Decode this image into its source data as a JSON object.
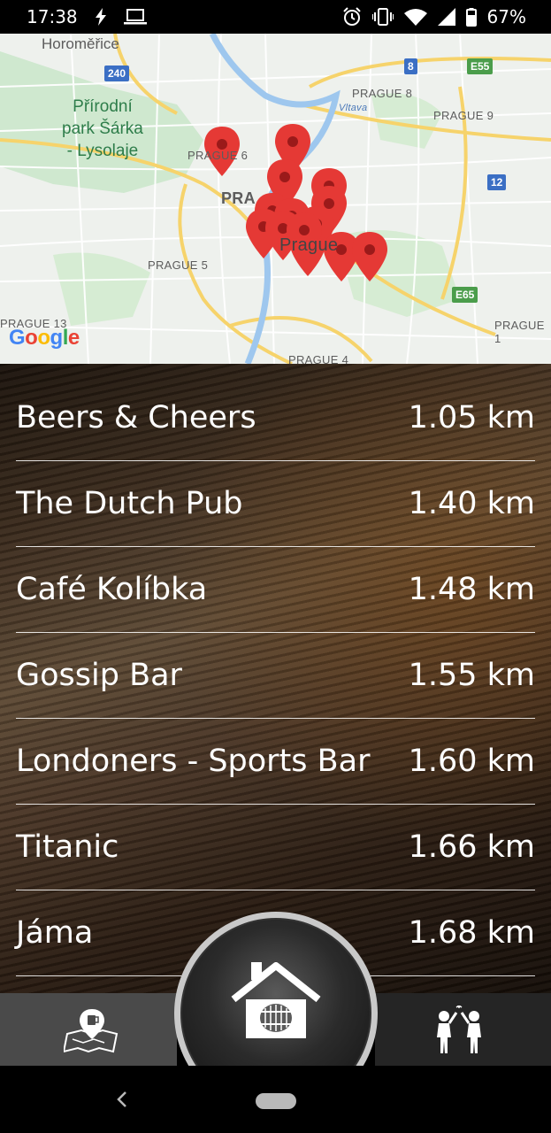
{
  "status_bar": {
    "time": "17:38",
    "battery_percent": "67%",
    "icons": [
      "flash-icon",
      "laptop-icon",
      "alarm-icon",
      "vibrate-icon",
      "wifi-icon",
      "signal-icon",
      "battery-icon"
    ]
  },
  "map": {
    "place_labels": [
      "Horoměřice",
      "PRAGUE 8",
      "PRAGUE 9",
      "PRAGUE 6",
      "PRA",
      "Prague",
      "PRAGUE 5",
      "PRAGUE 13",
      "PRAGUE 1",
      "PRAGUE 4"
    ],
    "park_label": [
      "Přírodní",
      "park Šárka",
      "- Lysolaje"
    ],
    "highway_labels": [
      "240",
      "8",
      "E55",
      "12",
      "E65"
    ],
    "river_label": "Vltava",
    "attribution": "Google",
    "marker_color": "#e53935",
    "marker_count": 14
  },
  "pubs": [
    {
      "name": "Beers & Cheers",
      "distance": "1.05 km"
    },
    {
      "name": "The Dutch Pub",
      "distance": "1.40 km"
    },
    {
      "name": "Café Kolíbka",
      "distance": "1.48 km"
    },
    {
      "name": "Gossip Bar",
      "distance": "1.55 km"
    },
    {
      "name": "Londoners - Sports Bar",
      "distance": "1.60 km"
    },
    {
      "name": "Titanic",
      "distance": "1.66 km"
    },
    {
      "name": "Jáma",
      "distance": "1.68 km"
    }
  ],
  "bottom_nav": {
    "left_icon": "map-pin-beer-icon",
    "center_icon": "house-barrel-icon",
    "right_icon": "friends-cheers-icon"
  }
}
